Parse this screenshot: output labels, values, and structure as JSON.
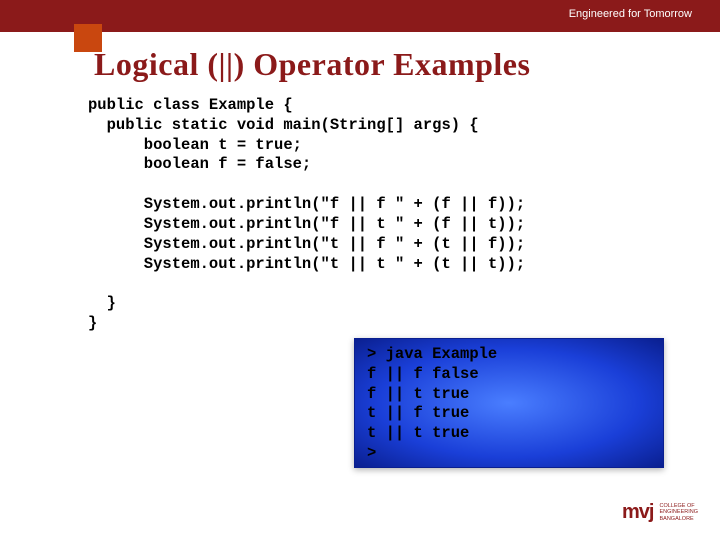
{
  "header": {
    "tagline": "Engineered for Tomorrow"
  },
  "title": "Logical (||) Operator Examples",
  "code": "public class Example {\n  public static void main(String[] args) {\n      boolean t = true;\n      boolean f = false;\n\n      System.out.println(\"f || f \" + (f || f));\n      System.out.println(\"f || t \" + (f || t));\n      System.out.println(\"t || f \" + (t || f));\n      System.out.println(\"t || t \" + (t || t));\n\n  }\n}",
  "output": "> java Example\nf || f false\nf || t true\nt || f true\nt || t true\n>",
  "logo": {
    "mark": "mvj",
    "line1": "COLLEGE OF",
    "line2": "ENGINEERING",
    "line3": "BANGALORE"
  }
}
